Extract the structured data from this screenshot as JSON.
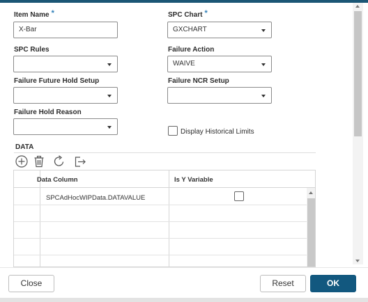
{
  "form": {
    "item_name": {
      "label": "Item Name",
      "required_mark": "*",
      "value": "X-Bar"
    },
    "spc_chart": {
      "label": "SPC Chart",
      "required_mark": "*",
      "value": "GXCHART"
    },
    "spc_rules": {
      "label": "SPC Rules",
      "value": ""
    },
    "failure_action": {
      "label": "Failure Action",
      "value": "WAIVE"
    },
    "failure_future_hold_setup": {
      "label": "Failure Future Hold Setup",
      "value": ""
    },
    "failure_ncr_setup": {
      "label": "Failure NCR Setup",
      "value": ""
    },
    "failure_hold_reason": {
      "label": "Failure Hold Reason",
      "value": ""
    },
    "display_historical_limits": {
      "label": "Display Historical Limits",
      "checked": false
    }
  },
  "data_section": {
    "title": "DATA",
    "toolbar": [
      "add-icon",
      "trash-icon",
      "refresh-icon",
      "export-icon"
    ],
    "columns": [
      "Data Column",
      "Is Y Variable"
    ],
    "rows": [
      {
        "data_column": "SPCAdHocWIPData.DATAVALUE",
        "is_y_variable": false
      }
    ]
  },
  "footer": {
    "close_label": "Close",
    "reset_label": "Reset",
    "ok_label": "OK"
  },
  "colors": {
    "primary": "#12587f",
    "required_star": "#2f7fb8",
    "top_bar": "#1b5675"
  }
}
